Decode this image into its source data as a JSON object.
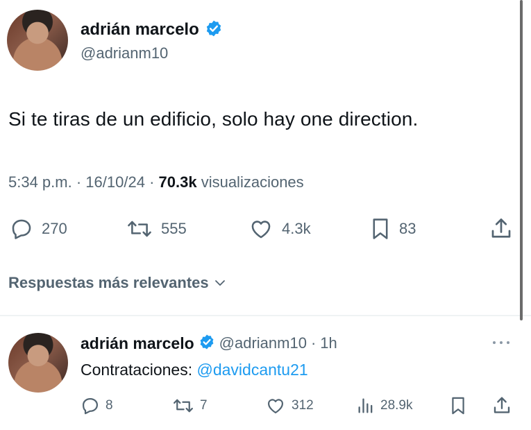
{
  "tweet": {
    "author_name": "adrián marcelo",
    "author_handle": "@adrianm10",
    "text": "Si te tiras de un edificio, solo hay one direction.",
    "time": "5:34 p.m.",
    "date": "16/10/24",
    "views_count": "70.3k",
    "views_label": "visualizaciones",
    "replies": "270",
    "retweets": "555",
    "likes": "4.3k",
    "bookmarks": "83"
  },
  "sort": {
    "label": "Respuestas más relevantes"
  },
  "reply": {
    "author_name": "adrián marcelo",
    "author_handle": "@adrianm10",
    "age": "1h",
    "text_prefix": "Contrataciones: ",
    "mention": "@davidcantu21",
    "replies": "8",
    "retweets": "7",
    "likes": "312",
    "views": "28.9k"
  },
  "colors": {
    "accent": "#1d9bf0",
    "text": "#0f1419",
    "muted": "#536471"
  },
  "icons": [
    "verified-icon",
    "reply-icon",
    "retweet-icon",
    "like-icon",
    "bookmark-icon",
    "share-icon",
    "views-icon",
    "more-icon",
    "chevron-down-icon"
  ]
}
